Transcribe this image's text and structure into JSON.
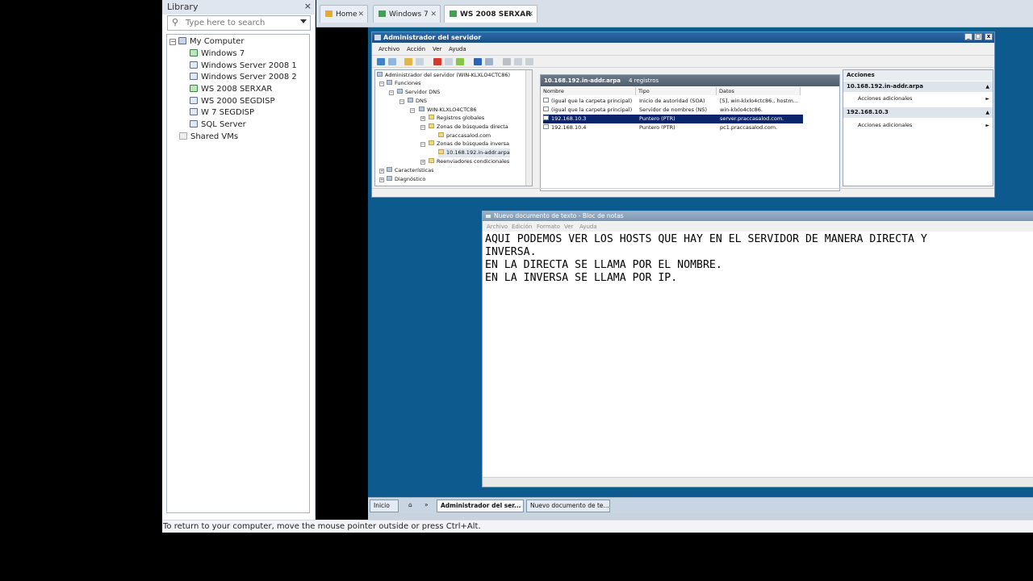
{
  "library": {
    "title": "Library",
    "close": "×",
    "search_placeholder": "Type here to search",
    "items": [
      {
        "label": "My Computer"
      },
      {
        "label": "Windows 7"
      },
      {
        "label": "Windows Server 2008 1"
      },
      {
        "label": "Windows Server 2008 2"
      },
      {
        "label": "WS 2008 SERXAR"
      },
      {
        "label": "WS 2000 SEGDISP"
      },
      {
        "label": "W 7 SEGDISP"
      },
      {
        "label": "SQL Server"
      },
      {
        "label": "Shared VMs"
      }
    ]
  },
  "tabs": [
    {
      "label": "Home"
    },
    {
      "label": "Windows 7"
    },
    {
      "label": "WS 2008 SERXAR"
    }
  ],
  "server_manager": {
    "title": "Administrador del servidor",
    "menu": [
      "Archivo",
      "Acción",
      "Ver",
      "Ayuda"
    ],
    "tree": [
      "Administrador del servidor (WIN-KLXLO4CTC86)",
      "Funciones",
      "Servidor DNS",
      "DNS",
      "WIN-KLXLO4CTC86",
      "Registros globales",
      "Zonas de búsqueda directa",
      "praccasalod.com",
      "Zonas de búsqueda inversa",
      "10.168.192.in-addr.arpa",
      "Reenviadores condicionales",
      "Características",
      "Diagnóstico"
    ],
    "center_header": "10.168.192.in-addr.arpa",
    "center_count": "4 registros",
    "columns": [
      "Nombre",
      "Tipo",
      "Datos"
    ],
    "records": [
      {
        "name": "(igual que la carpeta principal)",
        "type": "Inicio de autoridad (SOA)",
        "data": "[5], win-klxlo4ctc86., hostm..."
      },
      {
        "name": "(igual que la carpeta principal)",
        "type": "Servidor de nombres (NS)",
        "data": "win-klxlo4ctc86."
      },
      {
        "name": "192.168.10.3",
        "type": "Puntero (PTR)",
        "data": "server.praccasalod.com."
      },
      {
        "name": "192.168.10.4",
        "type": "Puntero (PTR)",
        "data": "pc1.praccasalod.com."
      }
    ],
    "actions_title": "Acciones",
    "actions": [
      {
        "header": "10.168.192.in-addr.arpa",
        "item": "Acciones adicionales"
      },
      {
        "header": "192.168.10.3",
        "item": "Acciones adicionales"
      }
    ]
  },
  "notepad": {
    "title": "Nuevo documento de texto - Bloc de notas",
    "menu": [
      "Archivo",
      "Edición",
      "Formato",
      "Ver",
      "Ayuda"
    ],
    "text": "AQUI PODEMOS VER LOS HOSTS QUE HAY EN EL SERVIDOR DE MANERA DIRECTA Y\nINVERSA.\nEN LA DIRECTA SE LLAMA POR EL NOMBRE.\nEN LA INVERSA SE LLAMA POR IP."
  },
  "taskbar": {
    "start": "Inicio",
    "chevron": "»",
    "items": [
      "Administrador del ser...",
      "Nuevo documento de te..."
    ]
  },
  "hint": "To return to your computer, move the mouse pointer outside or press Ctrl+Alt.",
  "colors": {
    "vm_desktop": "#0c5a8e",
    "selection": "#0a246a",
    "title_bar": "#1b4f86"
  }
}
